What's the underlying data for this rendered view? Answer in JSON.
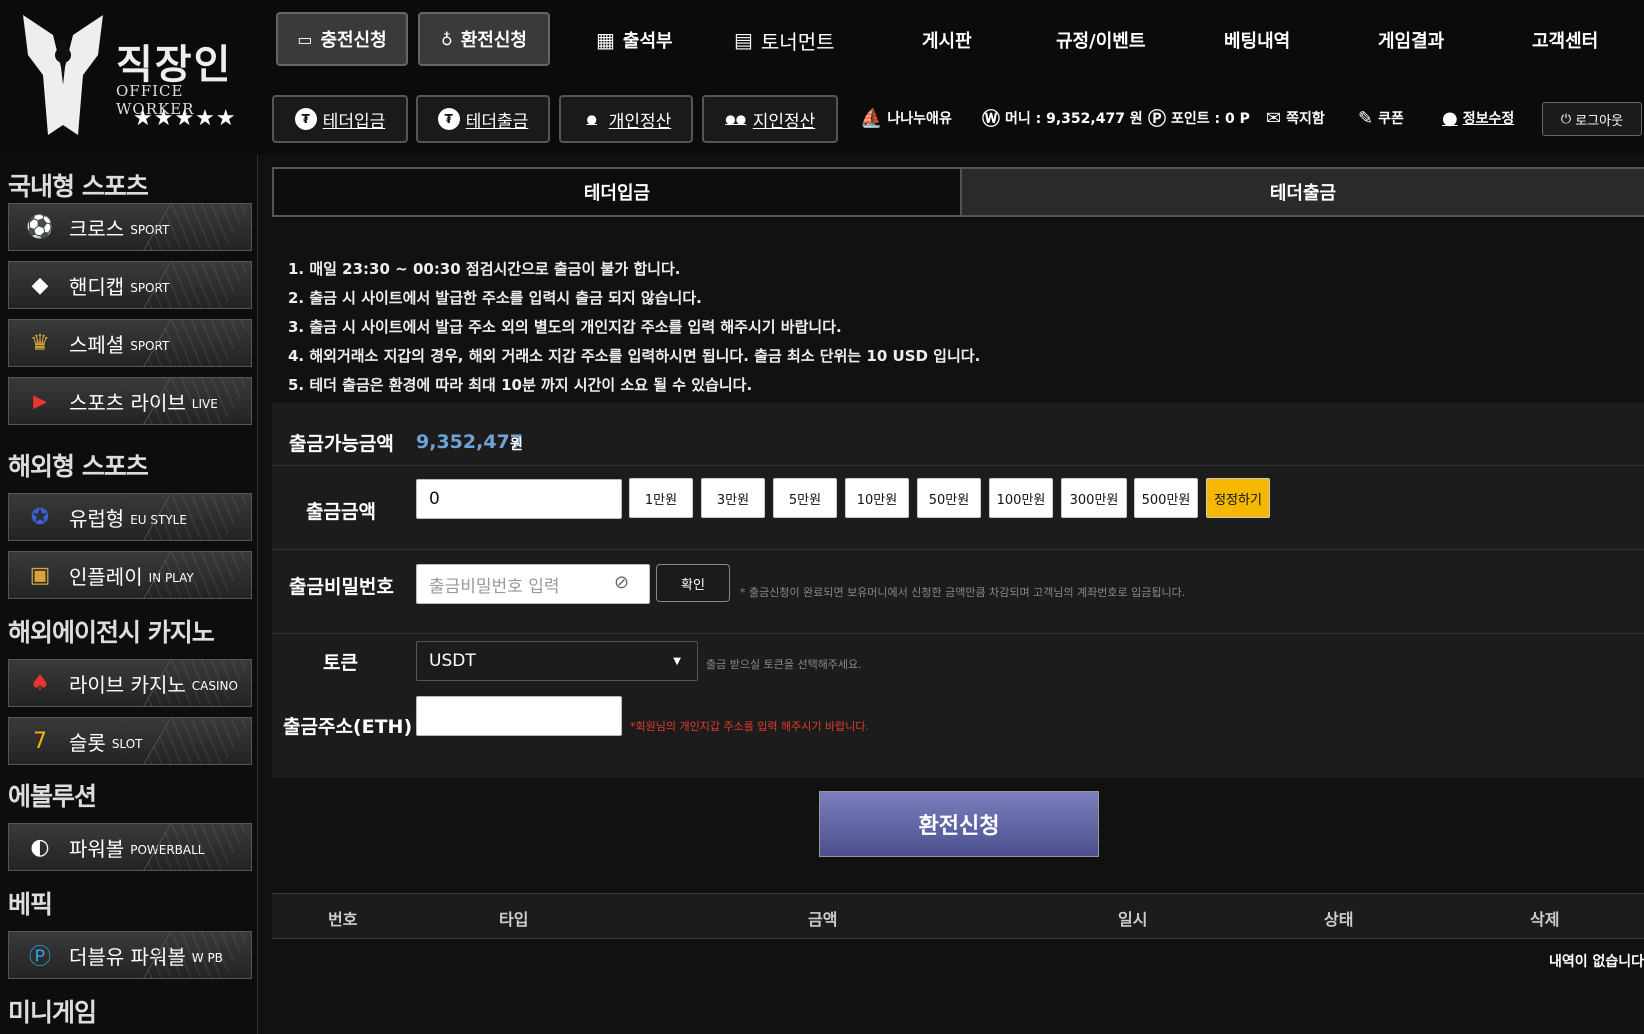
{
  "logo": {
    "brand": "직장인",
    "brand_sub": "OFFICE WORKER",
    "stars": "★★★★★"
  },
  "top_buttons": [
    {
      "label": "충전신청",
      "icon": "wallet-icon"
    },
    {
      "label": "환전신청",
      "icon": "money-bag-icon"
    }
  ],
  "top_links": [
    {
      "label": "출석부",
      "icon": "calendar-icon"
    },
    {
      "label": "토너먼트",
      "icon": "tournament-icon"
    },
    {
      "label": "게시판"
    },
    {
      "label": "규정/이벤트"
    },
    {
      "label": "베팅내역"
    },
    {
      "label": "게임결과"
    },
    {
      "label": "고객센터"
    }
  ],
  "sub_buttons": [
    {
      "label": "테더입금",
      "icon": "tether-icon"
    },
    {
      "label": "테더출금",
      "icon": "tether-icon"
    },
    {
      "label": "개인정산",
      "icon": "person-icon"
    },
    {
      "label": "지인정산",
      "icon": "people-icon"
    }
  ],
  "user": {
    "nickname": "나나누애유",
    "money": "머니 : 9,352,477 원",
    "point": "포인트 : 0 P",
    "message": "쪽지함",
    "coupon": "쿠폰",
    "profile": "정보수정",
    "logout": "로그아웃"
  },
  "sidebar": {
    "sections": [
      "국내형 스포츠",
      "해외형 스포츠",
      "해외에이전시 카지노",
      "에볼루션",
      "베픽",
      "미니게임"
    ],
    "items": [
      {
        "label": "크로스",
        "en": "SPORT",
        "icon": "soccer-icon"
      },
      {
        "label": "핸디캡",
        "en": "SPORT",
        "icon": "handicap-icon"
      },
      {
        "label": "스페셜",
        "en": "SPORT",
        "icon": "trophy-icon"
      },
      {
        "label": "스포츠 라이브",
        "en": "LIVE",
        "icon": "live-icon"
      },
      {
        "label": "유럽형",
        "en": "EU STYLE",
        "icon": "eu-flag-icon"
      },
      {
        "label": "인플레이",
        "en": "IN PLAY",
        "icon": "inplay-icon"
      },
      {
        "label": "라이브 카지노",
        "en": "CASINO",
        "icon": "cards-icon"
      },
      {
        "label": "슬롯",
        "en": "SLOT",
        "icon": "slot-icon"
      },
      {
        "label": "파워볼",
        "en": "POWERBALL",
        "icon": "powerball-icon"
      },
      {
        "label": "더블유 파워볼",
        "en": "W PB",
        "icon": "wpb-icon"
      }
    ]
  },
  "tabs": [
    {
      "label": "테더입금",
      "active": true
    },
    {
      "label": "테더출금",
      "active": false
    }
  ],
  "notices": [
    "1. 매일 23:30 ~ 00:30 점검시간으로 출금이 불가 합니다.",
    "2. 출금 시 사이트에서 발급한 주소를 입력시 출금 되지 않습니다.",
    "3. 출금 시 사이트에서 발급 주소 외의 별도의 개인지갑 주소를 입력 해주시기 바랍니다.",
    "4. 해외거래소 지갑의 경우, 해외 거래소 지갑 주소를 입력하시면 됩니다. 출금 최소 단위는 10 USD 입니다.",
    "5. 테더 출금은 환경에 따라 최대 10분 까지 시간이 소요 될 수 있습니다."
  ],
  "form": {
    "available_label": "출금가능금액",
    "available_value": "9,352,477",
    "available_unit": "원",
    "amount_label": "출금금액",
    "amount_value": "0",
    "amount_buttons": [
      "1만원",
      "3만원",
      "5만원",
      "10만원",
      "50만원",
      "100만원",
      "300만원",
      "500만원"
    ],
    "reset_label": "정정하기",
    "password_label": "출금비밀번호",
    "password_placeholder": "출금비밀번호 입력",
    "confirm_label": "확인",
    "password_hint": "* 출금신청이 완료되면 보유머니에서 신청한 금액만큼 차감되며 고객님의 계좌번호로 입금됩니다.",
    "token_label": "토큰",
    "token_value": "USDT",
    "token_hint": "출금 받으실 토큰을 선택해주세요.",
    "address_label": "출금주소(ETH)",
    "address_hint": "*회원님의 개인지갑 주소를 입력 해주시기 바랍니다."
  },
  "submit_label": "환전신청",
  "table": {
    "headers": [
      "번호",
      "타입",
      "금액",
      "일시",
      "상태",
      "삭제"
    ],
    "empty": "내역이 없습니다"
  }
}
